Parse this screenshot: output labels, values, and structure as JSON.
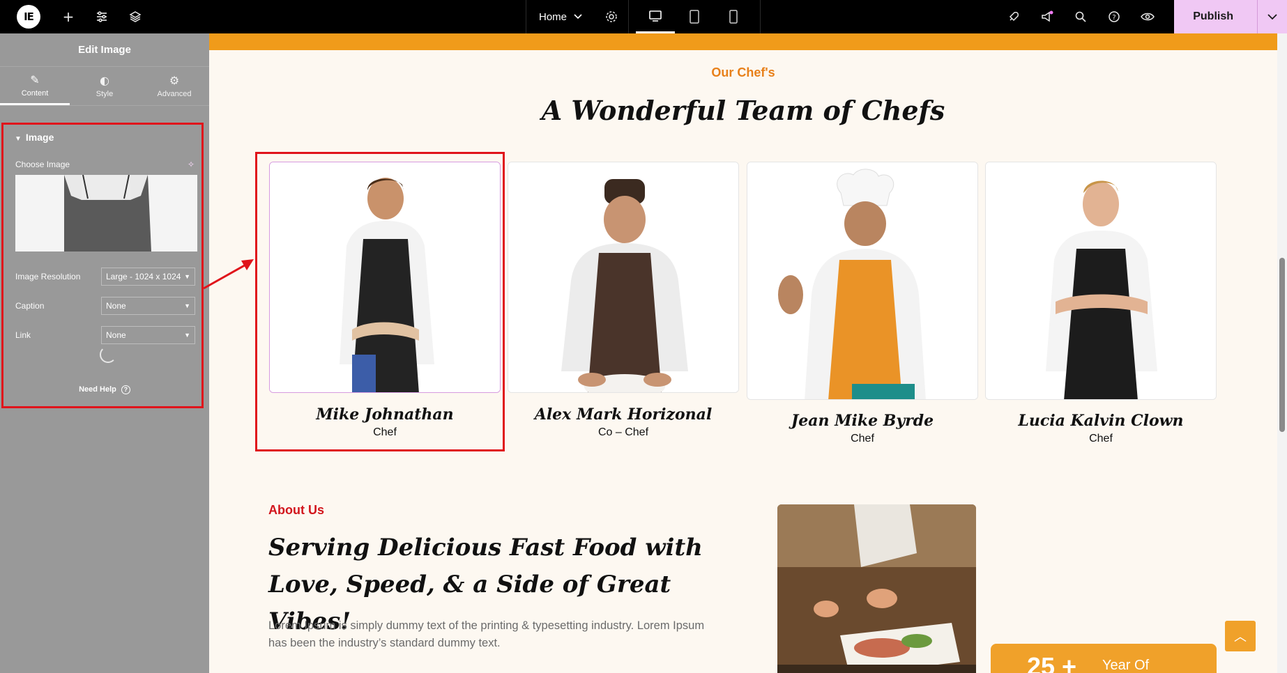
{
  "topbar": {
    "page_selector": "Home",
    "publish_label": "Publish"
  },
  "panel": {
    "title": "Edit Image",
    "tabs": [
      {
        "label": "Content",
        "icon": "pencil-icon"
      },
      {
        "label": "Style",
        "icon": "half-circle-icon"
      },
      {
        "label": "Advanced",
        "icon": "gear-icon"
      }
    ],
    "section_title": "Image",
    "choose_image_label": "Choose Image",
    "resolution_label": "Image Resolution",
    "resolution_value": "Large - 1024 x 1024",
    "caption_label": "Caption",
    "caption_value": "None",
    "link_label": "Link",
    "link_value": "None",
    "need_help": "Need Help"
  },
  "canvas": {
    "subtitle": "Our Chef's",
    "title": "A Wonderful Team of Chefs",
    "chefs": [
      {
        "name": "Mike Johnathan",
        "role": "Chef"
      },
      {
        "name": "Alex Mark Horizonal",
        "role": "Co – Chef"
      },
      {
        "name": "Jean Mike Byrde",
        "role": "Chef"
      },
      {
        "name": "Lucia Kalvin Clown",
        "role": "Chef"
      }
    ],
    "about_label": "About Us",
    "about_heading": "Serving Delicious Fast Food with Love, Speed, & a Side of Great Vibes!",
    "about_text": "Lorem Ipsum is simply dummy text of the printing & typesetting industry. Lorem Ipsum has been the industry’s standard dummy text.",
    "stat_number": "25 +",
    "stat_text": "Year Of"
  },
  "colors": {
    "accent_orange": "#f09b1a",
    "accent_red": "#d2161d",
    "publish_bg": "#f0c8f4",
    "panel_bg": "#999999"
  }
}
